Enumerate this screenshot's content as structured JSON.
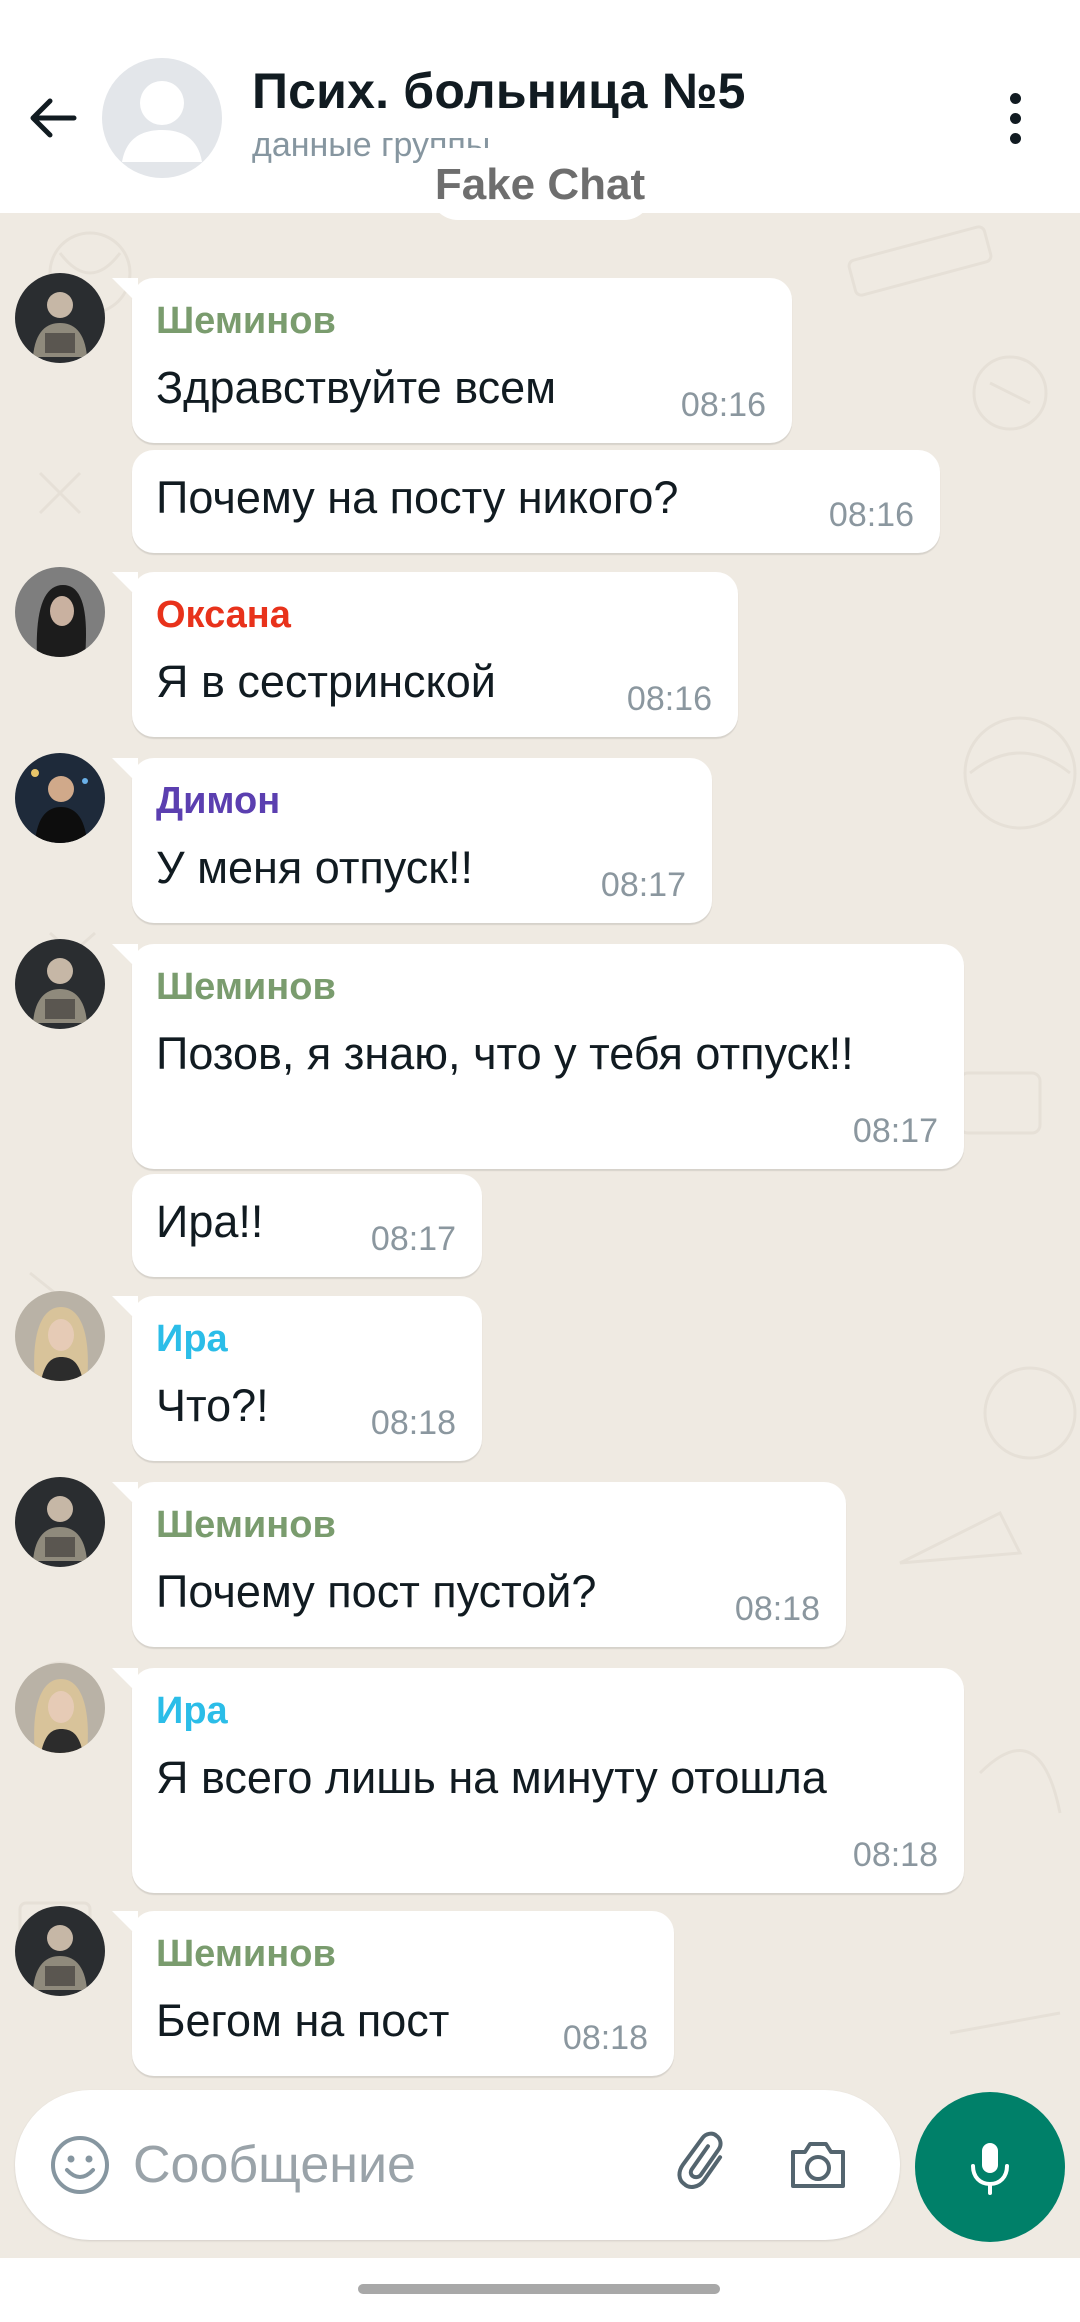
{
  "header": {
    "title": "Псих. больница №5",
    "subtitle": "данные группы",
    "watermark": "Fake Chat"
  },
  "colors": {
    "sheminov": "#7a9c6e",
    "oksana": "#e8321b",
    "dimon": "#5b3fb0",
    "ira": "#2bbde8",
    "accent": "#008069",
    "chat_background": "#efeae2"
  },
  "messages": [
    {
      "sender": "Шеминов",
      "text": "Здравствуйте всем",
      "time": "08:16"
    },
    {
      "sender": "",
      "text": "Почему на посту никого?",
      "time": "08:16"
    },
    {
      "sender": "Оксана",
      "text": "Я в сестринской",
      "time": "08:16"
    },
    {
      "sender": "Димон",
      "text": "У меня отпуск!!",
      "time": "08:17"
    },
    {
      "sender": "Шеминов",
      "text": "Позов, я знаю, что у тебя отпуск!!",
      "time": "08:17"
    },
    {
      "sender": "",
      "text": "Ира!!",
      "time": "08:17"
    },
    {
      "sender": "Ира",
      "text": "Что?!",
      "time": "08:18"
    },
    {
      "sender": "Шеминов",
      "text": "Почему пост пустой?",
      "time": "08:18"
    },
    {
      "sender": "Ира",
      "text": "Я всего лишь на минуту отошла",
      "time": "08:18"
    },
    {
      "sender": "Шеминов",
      "text": "Бегом на пост",
      "time": "08:18"
    }
  ],
  "input": {
    "placeholder": "Сообщение"
  },
  "icons": {
    "back": "arrow-left-icon",
    "menu": "vertical-dots-icon",
    "emoji": "smiley-icon",
    "attach": "paperclip-icon",
    "camera": "camera-icon",
    "mic": "microphone-icon"
  }
}
